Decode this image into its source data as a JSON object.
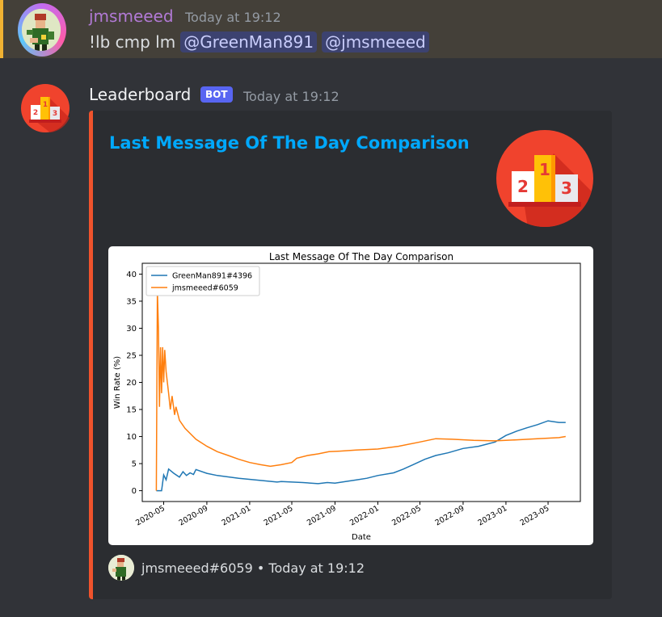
{
  "message1": {
    "username": "jmsmeeed",
    "timestamp": "Today at 19:12",
    "command": "!lb cmp lm",
    "mentions": [
      "@GreenMan891",
      "@jmsmeeed"
    ]
  },
  "message2": {
    "username": "Leaderboard",
    "bot_tag": "BOT",
    "timestamp": "Today at 19:12",
    "embed": {
      "accent_color": "#f0532c",
      "title": "Last Message Of The Day Comparison",
      "footer_author": "jmsmeeed#6059",
      "footer_separator": "•",
      "footer_time": "Today at 19:12",
      "thumbnail_icon": "podium-icon",
      "thumbnail_labels": [
        "2",
        "1",
        "3"
      ]
    }
  },
  "chart_data": {
    "type": "line",
    "title": "Last Message Of The Day Comparison",
    "xlabel": "Date",
    "ylabel": "Win Rate (%)",
    "ylim": [
      0,
      40
    ],
    "yticks": [
      0,
      5,
      10,
      15,
      20,
      25,
      30,
      35,
      40
    ],
    "xticks": [
      "2020-05",
      "2020-09",
      "2021-01",
      "2021-05",
      "2021-09",
      "2022-01",
      "2022-05",
      "2022-09",
      "2023-01",
      "2023-05"
    ],
    "legend_position": "top-left",
    "grid": false,
    "series": [
      {
        "name": "GreenMan891#4396",
        "color": "#1f77b4",
        "points": [
          [
            "2020-04-10",
            0
          ],
          [
            "2020-04-25",
            0
          ],
          [
            "2020-05-01",
            2.9
          ],
          [
            "2020-05-08",
            2.0
          ],
          [
            "2020-05-15",
            4.0
          ],
          [
            "2020-05-30",
            3.2
          ],
          [
            "2020-06-15",
            2.5
          ],
          [
            "2020-06-25",
            3.5
          ],
          [
            "2020-07-05",
            2.8
          ],
          [
            "2020-07-15",
            3.3
          ],
          [
            "2020-07-25",
            3.0
          ],
          [
            "2020-08-01",
            3.9
          ],
          [
            "2020-09-01",
            3.2
          ],
          [
            "2020-10-01",
            2.8
          ],
          [
            "2020-12-01",
            2.3
          ],
          [
            "2021-02-01",
            1.9
          ],
          [
            "2021-03-20",
            1.6
          ],
          [
            "2021-04-01",
            1.7
          ],
          [
            "2021-06-01",
            1.5
          ],
          [
            "2021-07-15",
            1.3
          ],
          [
            "2021-08-10",
            1.5
          ],
          [
            "2021-09-01",
            1.4
          ],
          [
            "2021-10-01",
            1.7
          ],
          [
            "2021-11-01",
            2.0
          ],
          [
            "2021-12-01",
            2.3
          ],
          [
            "2022-01-01",
            2.8
          ],
          [
            "2022-02-15",
            3.3
          ],
          [
            "2022-03-15",
            4.0
          ],
          [
            "2022-04-15",
            4.9
          ],
          [
            "2022-05-15",
            5.8
          ],
          [
            "2022-06-15",
            6.5
          ],
          [
            "2022-07-20",
            7.0
          ],
          [
            "2022-09-01",
            7.8
          ],
          [
            "2022-10-15",
            8.2
          ],
          [
            "2022-12-01",
            9.0
          ],
          [
            "2023-01-01",
            10.2
          ],
          [
            "2023-02-01",
            11.0
          ],
          [
            "2023-03-01",
            11.6
          ],
          [
            "2023-04-01",
            12.2
          ],
          [
            "2023-05-01",
            12.9
          ],
          [
            "2023-06-01",
            12.6
          ],
          [
            "2023-06-20",
            12.6
          ]
        ]
      },
      {
        "name": "jmsmeeed#6059",
        "color": "#ff7f0e",
        "points": [
          [
            "2020-04-10",
            0
          ],
          [
            "2020-04-13",
            37
          ],
          [
            "2020-04-16",
            30
          ],
          [
            "2020-04-19",
            15.5
          ],
          [
            "2020-04-22",
            26.5
          ],
          [
            "2020-04-25",
            18
          ],
          [
            "2020-04-28",
            26.5
          ],
          [
            "2020-05-01",
            20
          ],
          [
            "2020-05-04",
            26
          ],
          [
            "2020-05-08",
            22
          ],
          [
            "2020-05-15",
            18
          ],
          [
            "2020-05-20",
            15
          ],
          [
            "2020-05-25",
            17.5
          ],
          [
            "2020-06-01",
            14
          ],
          [
            "2020-06-05",
            15.5
          ],
          [
            "2020-06-15",
            13
          ],
          [
            "2020-07-01",
            11.5
          ],
          [
            "2020-08-01",
            9.5
          ],
          [
            "2020-09-01",
            8.2
          ],
          [
            "2020-10-01",
            7.2
          ],
          [
            "2020-11-01",
            6.5
          ],
          [
            "2020-12-01",
            5.8
          ],
          [
            "2021-01-01",
            5.2
          ],
          [
            "2021-02-01",
            4.8
          ],
          [
            "2021-03-01",
            4.5
          ],
          [
            "2021-04-01",
            4.8
          ],
          [
            "2021-05-01",
            5.2
          ],
          [
            "2021-05-15",
            6.0
          ],
          [
            "2021-06-15",
            6.5
          ],
          [
            "2021-07-15",
            6.8
          ],
          [
            "2021-08-15",
            7.2
          ],
          [
            "2021-09-15",
            7.3
          ],
          [
            "2021-11-01",
            7.5
          ],
          [
            "2022-01-01",
            7.7
          ],
          [
            "2022-03-01",
            8.2
          ],
          [
            "2022-05-01",
            9.0
          ],
          [
            "2022-06-15",
            9.6
          ],
          [
            "2022-08-01",
            9.5
          ],
          [
            "2022-10-01",
            9.3
          ],
          [
            "2022-12-01",
            9.2
          ],
          [
            "2023-02-01",
            9.4
          ],
          [
            "2023-04-01",
            9.6
          ],
          [
            "2023-06-01",
            9.8
          ],
          [
            "2023-06-20",
            10.0
          ]
        ]
      }
    ]
  }
}
